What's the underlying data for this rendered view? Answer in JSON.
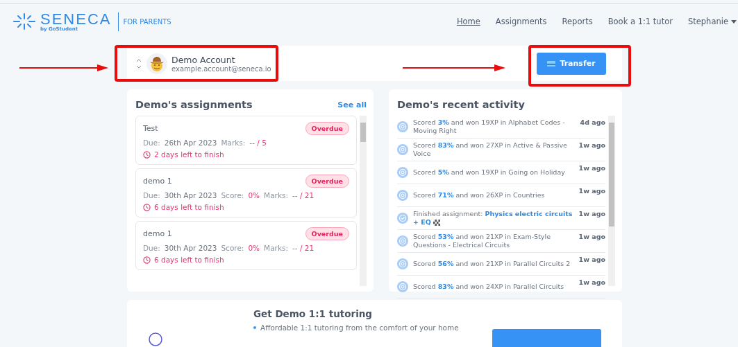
{
  "header": {
    "brand": "SENECA",
    "brand_sub": "by GoStudent",
    "section": "FOR PARENTS",
    "nav": [
      {
        "label": "Home",
        "selected": true
      },
      {
        "label": "Assignments",
        "selected": false
      },
      {
        "label": "Reports",
        "selected": false
      },
      {
        "label": "Book a 1:1 tutor",
        "selected": false
      }
    ],
    "user": "Stephanie"
  },
  "account": {
    "name": "Demo Account",
    "email": "example.account@seneca.io",
    "button": "Transfer"
  },
  "assignments": {
    "title": "Demo's assignments",
    "link": "See all",
    "items": [
      {
        "title": "Test",
        "badge": "Overdue",
        "meta": [
          {
            "label": "Due:",
            "value": "26th Apr 2023",
            "kind": "plain"
          },
          {
            "label": "Marks:",
            "value": "-- / 5",
            "kind": "alert"
          }
        ],
        "remaining": "2 days left to finish"
      },
      {
        "title": "demo 1",
        "badge": "Overdue",
        "meta": [
          {
            "label": "Due:",
            "value": "30th Apr 2023",
            "kind": "plain"
          },
          {
            "label": "Score:",
            "value": "0%",
            "kind": "alert"
          },
          {
            "label": "Marks:",
            "value": "-- / 21",
            "kind": "alert"
          }
        ],
        "remaining": "6 days left to finish"
      },
      {
        "title": "demo 1",
        "badge": "Overdue",
        "meta": [
          {
            "label": "Due:",
            "value": "30th Apr 2023",
            "kind": "plain"
          },
          {
            "label": "Score:",
            "value": "0%",
            "kind": "alert"
          },
          {
            "label": "Marks:",
            "value": "-- / 21",
            "kind": "alert"
          }
        ],
        "remaining": "6 days left to finish"
      }
    ]
  },
  "activity": {
    "title": "Demo's recent activity",
    "items": [
      {
        "kind": "scored",
        "text": "Scored **3%** and won 19XP in Alphabet Codes - Moving Right",
        "time": "4d ago"
      },
      {
        "kind": "scored",
        "text": "Scored **83%** and won 27XP in Active & Passive Voice",
        "time": "1w ago"
      },
      {
        "kind": "scored",
        "text": "Scored **5%** and won 19XP in Going on Holiday",
        "time": "1w ago"
      },
      {
        "kind": "scored",
        "text": "Scored **71%** and won 26XP in Countries",
        "time": "1w ago"
      },
      {
        "kind": "finished",
        "text": "Finished assignment: **Physics electric circuits + EQ**",
        "time": "1w ago"
      },
      {
        "kind": "scored",
        "text": "Scored **53%** and won 21XP in Exam-Style Questions - Electrical Circuits",
        "time": "1w ago"
      },
      {
        "kind": "scored",
        "text": "Scored **56%** and won 21XP in Parallel Circuits 2",
        "time": "1w ago"
      },
      {
        "kind": "scored",
        "text": "Scored **83%** and won 24XP in Parallel Circuits",
        "time": "1w ago"
      }
    ]
  },
  "tutoring": {
    "title": "Get Demo 1:1 tutoring",
    "bullets": [
      "Affordable 1:1 tutoring from the comfort of your home"
    ]
  }
}
